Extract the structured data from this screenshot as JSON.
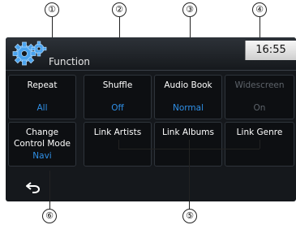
{
  "callouts": [
    "①",
    "②",
    "③",
    "④",
    "⑤",
    "⑥"
  ],
  "header": {
    "title": "Function",
    "clock": "16:55"
  },
  "row1": [
    {
      "label": "Repeat",
      "value": "All"
    },
    {
      "label": "Shuffle",
      "value": "Off"
    },
    {
      "label": "Audio Book",
      "value": "Normal"
    },
    {
      "label": "Widescreen",
      "value": "On"
    }
  ],
  "row2": {
    "change_mode": {
      "line1": "Change",
      "line2": "Control Mode",
      "value": "Navi"
    },
    "links": [
      "Link Artists",
      "Link Albums",
      "Link Genre"
    ]
  },
  "icons": {
    "gear": "gear-icon",
    "back": "back-arrow-icon"
  },
  "colors": {
    "value_blue": "#2f8fe6",
    "disabled": "#5d636a",
    "background": "#15181c"
  }
}
